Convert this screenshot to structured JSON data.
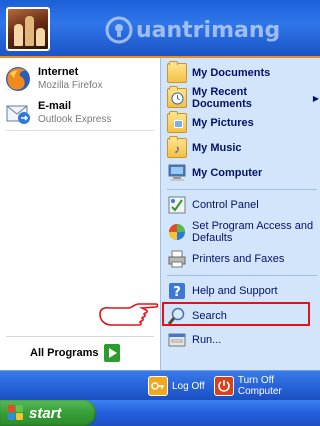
{
  "watermark": {
    "text": "uantrimang"
  },
  "pinned": [
    {
      "name": "Internet",
      "subtitle": "Mozilla Firefox"
    },
    {
      "name": "E-mail",
      "subtitle": "Outlook Express"
    }
  ],
  "all_programs": {
    "label": "All Programs"
  },
  "places": [
    {
      "label": "My Documents",
      "icon": "documents-folder-icon"
    },
    {
      "label": "My Recent Documents",
      "icon": "recent-documents-icon",
      "arrow": "▶"
    },
    {
      "label": "My Pictures",
      "icon": "pictures-folder-icon"
    },
    {
      "label": "My Music",
      "icon": "music-folder-icon"
    },
    {
      "label": "My Computer",
      "icon": "computer-icon"
    }
  ],
  "system": [
    {
      "label": "Control Panel",
      "icon": "control-panel-icon"
    },
    {
      "label": "Set Program Access and Defaults",
      "icon": "program-access-icon"
    },
    {
      "label": "Printers and Faxes",
      "icon": "printer-icon"
    }
  ],
  "help": [
    {
      "label": "Help and Support",
      "icon": "help-icon"
    },
    {
      "label": "Search",
      "icon": "search-icon"
    },
    {
      "label": "Run...",
      "icon": "run-icon"
    }
  ],
  "bottom": {
    "logoff_label": "Log Off",
    "turnoff_label": "Turn Off Computer"
  },
  "taskbar": {
    "start_label": "start"
  },
  "colors": {
    "highlight_box": "#e0121a",
    "annotation_hand": "#e0121a",
    "right_pane": "#d3e5fa"
  }
}
